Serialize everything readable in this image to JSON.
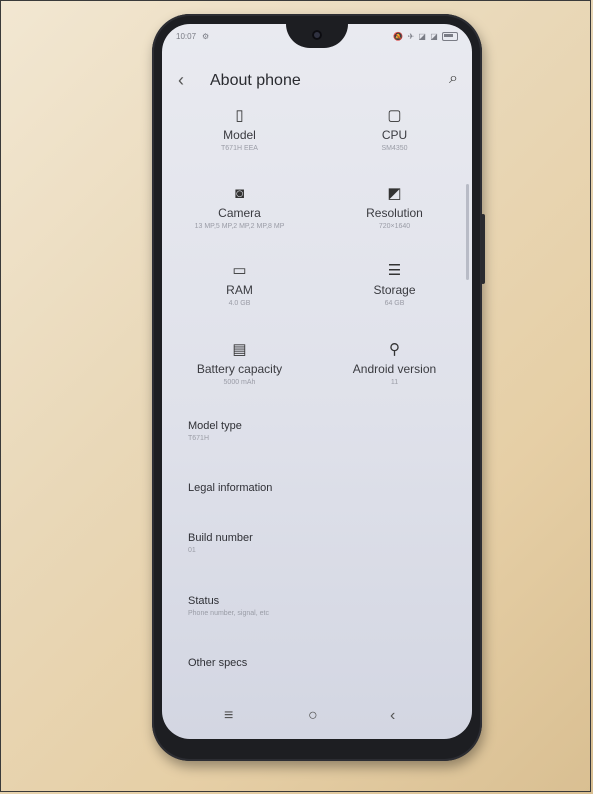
{
  "status": {
    "time": "10:07",
    "gear": "⚙",
    "right_icons": "🔕 ✈ ◪ ◪"
  },
  "appbar": {
    "back": "‹",
    "title": "About phone",
    "search": "⌕"
  },
  "specs": [
    {
      "icon": "▯",
      "label": "Model",
      "value": "T671H EEA"
    },
    {
      "icon": "▢",
      "label": "CPU",
      "value": "SM4350"
    },
    {
      "icon": "◙",
      "label": "Camera",
      "value": "13 MP,5 MP,2 MP,2 MP,8 MP"
    },
    {
      "icon": "◩",
      "label": "Resolution",
      "value": "720×1640"
    },
    {
      "icon": "▭",
      "label": "RAM",
      "value": "4.0 GB"
    },
    {
      "icon": "☰",
      "label": "Storage",
      "value": "64 GB"
    },
    {
      "icon": "▤",
      "label": "Battery capacity",
      "value": "5000 mAh"
    },
    {
      "icon": "⚲",
      "label": "Android version",
      "value": "11"
    }
  ],
  "list": {
    "model_type": {
      "title": "Model type",
      "sub": "T671H"
    },
    "legal": {
      "title": "Legal information"
    },
    "build": {
      "title": "Build number",
      "sub": "01"
    },
    "status": {
      "title": "Status",
      "sub": "Phone number, signal, etc"
    },
    "other": {
      "title": "Other specs"
    }
  },
  "nav": {
    "menu": "≡",
    "home": "○",
    "back": "‹"
  }
}
